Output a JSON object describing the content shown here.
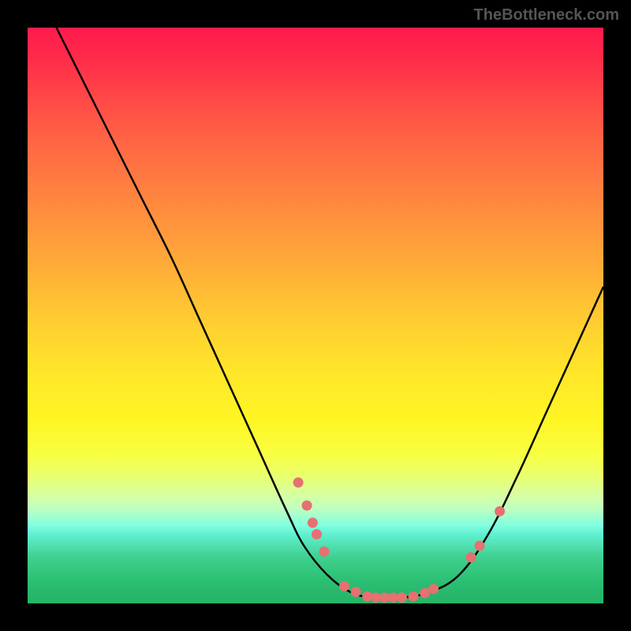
{
  "watermark": "TheBottleneck.com",
  "chart_data": {
    "type": "line",
    "title": "",
    "xlabel": "",
    "ylabel": "",
    "xlim": [
      0,
      100
    ],
    "ylim": [
      0,
      100
    ],
    "curve": [
      {
        "x": 5,
        "y": 100
      },
      {
        "x": 10,
        "y": 90
      },
      {
        "x": 15,
        "y": 80
      },
      {
        "x": 20,
        "y": 70
      },
      {
        "x": 25,
        "y": 60
      },
      {
        "x": 30,
        "y": 49
      },
      {
        "x": 35,
        "y": 38
      },
      {
        "x": 40,
        "y": 27
      },
      {
        "x": 45,
        "y": 16
      },
      {
        "x": 48,
        "y": 10
      },
      {
        "x": 52,
        "y": 5
      },
      {
        "x": 56,
        "y": 2
      },
      {
        "x": 60,
        "y": 1
      },
      {
        "x": 65,
        "y": 1
      },
      {
        "x": 70,
        "y": 2
      },
      {
        "x": 75,
        "y": 5
      },
      {
        "x": 80,
        "y": 12
      },
      {
        "x": 85,
        "y": 22
      },
      {
        "x": 90,
        "y": 33
      },
      {
        "x": 95,
        "y": 44
      },
      {
        "x": 100,
        "y": 55
      }
    ],
    "markers": [
      {
        "x": 47,
        "y": 21
      },
      {
        "x": 48.5,
        "y": 17
      },
      {
        "x": 49.5,
        "y": 14
      },
      {
        "x": 50.2,
        "y": 12
      },
      {
        "x": 51.5,
        "y": 9
      },
      {
        "x": 55,
        "y": 3
      },
      {
        "x": 57,
        "y": 2
      },
      {
        "x": 59,
        "y": 1.2
      },
      {
        "x": 60.5,
        "y": 1
      },
      {
        "x": 62,
        "y": 1
      },
      {
        "x": 63.5,
        "y": 1
      },
      {
        "x": 65,
        "y": 1
      },
      {
        "x": 67,
        "y": 1.2
      },
      {
        "x": 69,
        "y": 1.8
      },
      {
        "x": 70.5,
        "y": 2.5
      },
      {
        "x": 77,
        "y": 8
      },
      {
        "x": 78.5,
        "y": 10
      },
      {
        "x": 82,
        "y": 16
      }
    ],
    "marker_color": "#e77070",
    "curve_color": "#000000"
  }
}
